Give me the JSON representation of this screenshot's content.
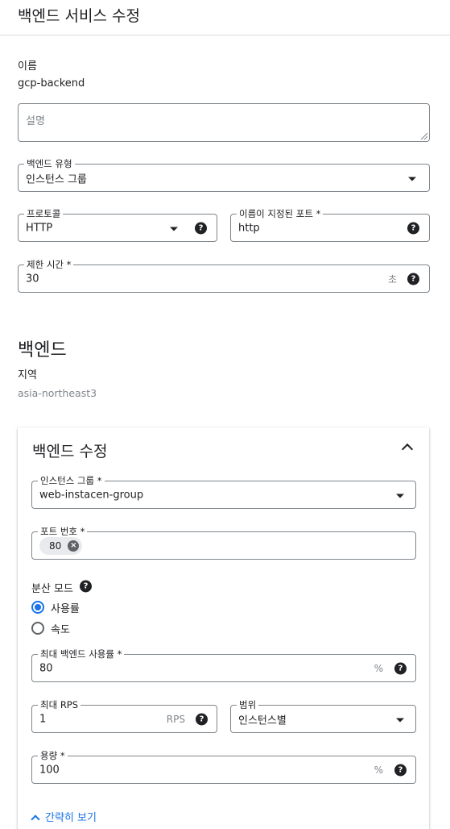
{
  "header": {
    "title": "백엔드 서비스 수정"
  },
  "name": {
    "label": "이름",
    "value": "gcp-backend"
  },
  "description": {
    "placeholder": "설명"
  },
  "backend_type": {
    "label": "백엔드 유형",
    "value": "인스턴스 그룹"
  },
  "protocol": {
    "label": "프로토콜",
    "value": "HTTP"
  },
  "named_port": {
    "label": "이름이 지정된 포트 *",
    "value": "http"
  },
  "timeout": {
    "label": "제한 시간 *",
    "value": "30",
    "unit": "초"
  },
  "backends_section": {
    "title": "백엔드",
    "region_label": "지역",
    "region_value": "asia-northeast3"
  },
  "backend_edit": {
    "title": "백엔드 수정",
    "instance_group": {
      "label": "인스턴스 그룹 *",
      "value": "web-instacen-group"
    },
    "port_numbers": {
      "label": "포트 번호 *",
      "chips": [
        "80"
      ]
    },
    "balancing_mode": {
      "label": "분산 모드",
      "options": [
        {
          "label": "사용률",
          "selected": true
        },
        {
          "label": "속도",
          "selected": false
        }
      ]
    },
    "max_utilization": {
      "label": "최대 백엔드 사용률 *",
      "value": "80",
      "unit": "%"
    },
    "max_rps": {
      "label": "최대 RPS",
      "value": "1",
      "unit": "RPS"
    },
    "scope": {
      "label": "범위",
      "value": "인스턴스별"
    },
    "capacity": {
      "label": "용량 *",
      "value": "100",
      "unit": "%"
    },
    "collapse_link": "간략히 보기"
  },
  "colors": {
    "accent": "#1a73e8",
    "border": "#80868b",
    "text": "#202124"
  },
  "icons": {
    "help": "help-circle-icon",
    "dropdown": "caret-down-icon",
    "chip_remove": "cancel-icon",
    "collapse": "chevron-up-icon"
  }
}
